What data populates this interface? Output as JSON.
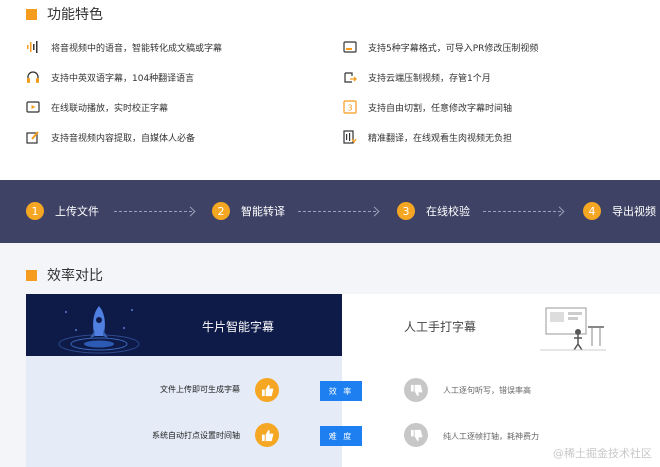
{
  "features": {
    "title": "功能特色",
    "items": [
      {
        "text": "将音视频中的语音，智能转化成文稿或字幕",
        "icon": "audio-wave-icon"
      },
      {
        "text": "支持5种字幕格式，可导入PR修改压制视频",
        "icon": "subtitle-format-icon"
      },
      {
        "text": "支持中英双语字幕，104种翻译语言",
        "icon": "headphones-icon"
      },
      {
        "text": "支持云端压制视频，存管1个月",
        "icon": "cloud-export-icon"
      },
      {
        "text": "在线联动播放，实时校正字幕",
        "icon": "video-play-icon"
      },
      {
        "text": "支持自由切割，任意修改字幕时间轴",
        "icon": "timeline-edit-icon"
      },
      {
        "text": "支持音视频内容提取，自媒体人必备",
        "icon": "extract-edit-icon"
      },
      {
        "text": "精准翻译，在线观看生肉视频无负担",
        "icon": "translate-icon"
      }
    ]
  },
  "steps": [
    {
      "num": "1",
      "label": "上传文件"
    },
    {
      "num": "2",
      "label": "智能转译"
    },
    {
      "num": "3",
      "label": "在线校验"
    },
    {
      "num": "4",
      "label": "导出视频"
    }
  ],
  "compare": {
    "title": "效率对比",
    "left_head": "牛片智能字幕",
    "right_head": "人工手打字幕",
    "rows": [
      {
        "left": "文件上传即可生成字幕",
        "badge": "效 率",
        "right": "人工逐句听写，错误率高"
      },
      {
        "left": "系统自动打点设置时间轴",
        "badge": "难 度",
        "right": "纯人工逐帧打轴，耗神费力"
      }
    ]
  },
  "watermark": "@稀土掘金技术社区",
  "colors": {
    "accent": "#f59b1d",
    "steps_bg": "#3e4366",
    "dark_head": "#0e1a48",
    "badge_blue": "#1e7ff0"
  }
}
